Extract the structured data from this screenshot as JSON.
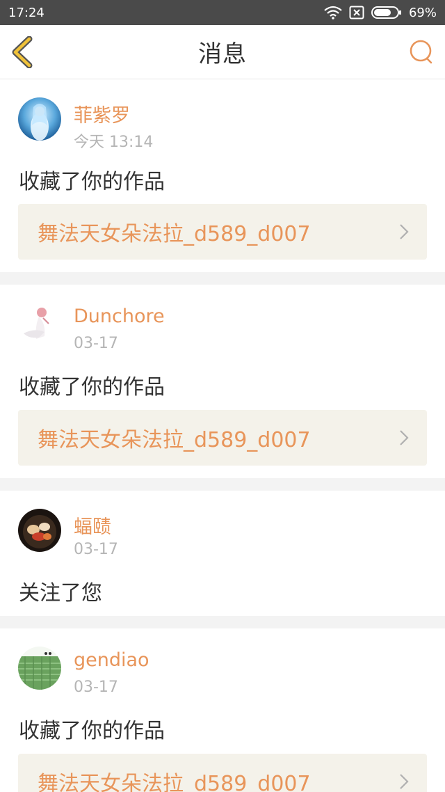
{
  "status": {
    "time": "17:24",
    "battery": "69%"
  },
  "nav": {
    "title": "消息"
  },
  "messages": [
    {
      "user": "菲紫罗",
      "time": "今天 13:14",
      "action": "收藏了你的作品",
      "work": "舞法天女朵法拉_d589_d007"
    },
    {
      "user": "Dunchore",
      "time": "03-17",
      "action": "收藏了你的作品",
      "work": "舞法天女朵法拉_d589_d007"
    },
    {
      "user": "蝠赜",
      "time": "03-17",
      "action": "关注了您"
    },
    {
      "user": "gendiao",
      "time": "03-17",
      "action": "收藏了你的作品",
      "work": "舞法天女朵法拉_d589_d007"
    }
  ],
  "colors": {
    "accent": "#e8955a",
    "back_arrow": "#f0c23a",
    "card_bg": "#f4f2ea"
  }
}
